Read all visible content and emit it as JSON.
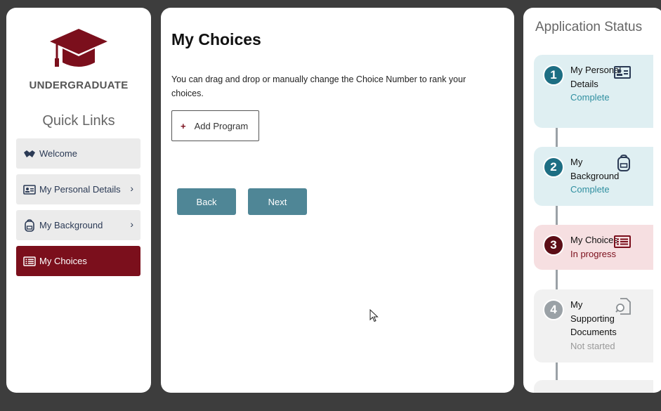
{
  "app": {
    "brand": "UNDERGRADUATE",
    "quick_links_title": "Quick Links"
  },
  "nav": {
    "items": [
      {
        "label": "Welcome",
        "icon": "handshake-icon"
      },
      {
        "label": "My Personal Details",
        "icon": "id-card-icon",
        "chevron": "›"
      },
      {
        "label": "My Background",
        "icon": "backpack-icon",
        "chevron": "›"
      },
      {
        "label": "My Choices",
        "icon": "list-icon",
        "active": true
      }
    ]
  },
  "main": {
    "title": "My Choices",
    "description": "You can drag and drop or manually change the Choice Number to rank your choices.",
    "add_program_label": "Add Program",
    "add_program_icon": "+",
    "back_label": "Back",
    "next_label": "Next"
  },
  "status": {
    "title": "Application Status",
    "steps": [
      {
        "number": "1",
        "label": "My Personal Details",
        "status": "Complete",
        "state": "complete",
        "icon": "id-card-icon"
      },
      {
        "number": "2",
        "label": "My Background",
        "status": "Complete",
        "state": "complete",
        "icon": "backpack-icon"
      },
      {
        "number": "3",
        "label": "My Choices",
        "status": "In progress",
        "state": "in-progress",
        "icon": "list-icon"
      },
      {
        "number": "4",
        "label": "My Supporting Documents",
        "status": "Not started",
        "state": "not-started",
        "icon": "document-search-icon"
      }
    ]
  },
  "colors": {
    "brand": "#7b0f1c",
    "button": "#4f8696",
    "complete_text": "#2f8fa0",
    "complete_circle": "#1d6e83",
    "progress_text": "#7b0f1c",
    "pending": "#9aa1a6"
  }
}
